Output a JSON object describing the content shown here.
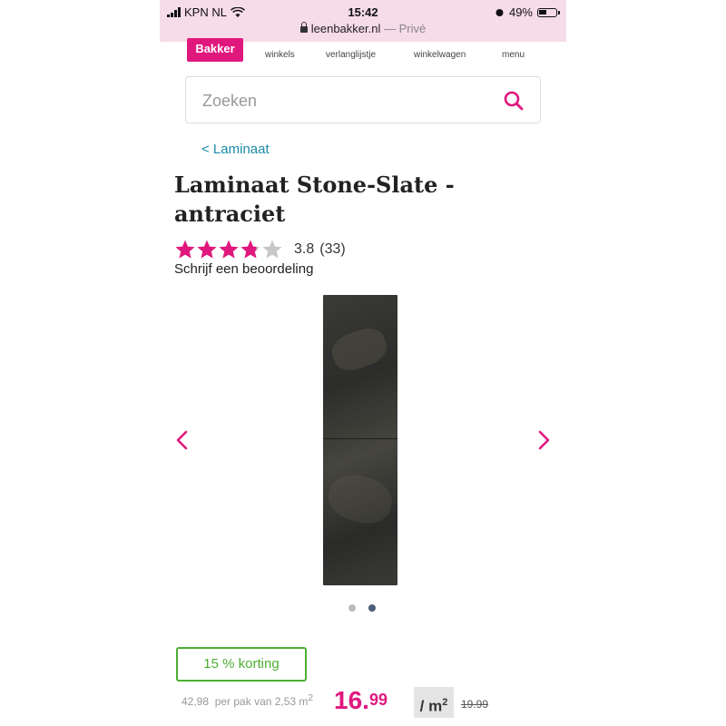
{
  "status_bar": {
    "carrier": "KPN NL",
    "time": "15:42",
    "battery": "49%",
    "battery_level": 0.49
  },
  "browser": {
    "url": "leenbakker.nl",
    "privacy": "— Privé"
  },
  "nav": {
    "logo": "Bakker",
    "items": [
      "winkels",
      "verlanglijstje",
      "winkelwagen",
      "menu"
    ]
  },
  "search": {
    "placeholder": "Zoeken",
    "icon": "search-icon"
  },
  "breadcrumb": "< Laminaat",
  "product": {
    "title": "Laminaat Stone-Slate - antraciet",
    "rating": 3.8,
    "rating_text": "3.8",
    "review_count": "(33)",
    "write_review": "Schrijf een beoordeling",
    "image_count": 2,
    "active_image": 2
  },
  "pricing": {
    "discount_badge": "15 % korting",
    "pack_price": "42,98",
    "per_pack_text": "per pak van 2,53 m",
    "price_main": "16.",
    "price_cents": "99",
    "unit": "/ m",
    "unit_sup": "2",
    "old_price": "19.99"
  },
  "colors": {
    "brand": "#e0187e",
    "link": "#1a8ba8",
    "discount": "#4caf32",
    "star_empty": "#c8c8c8"
  }
}
